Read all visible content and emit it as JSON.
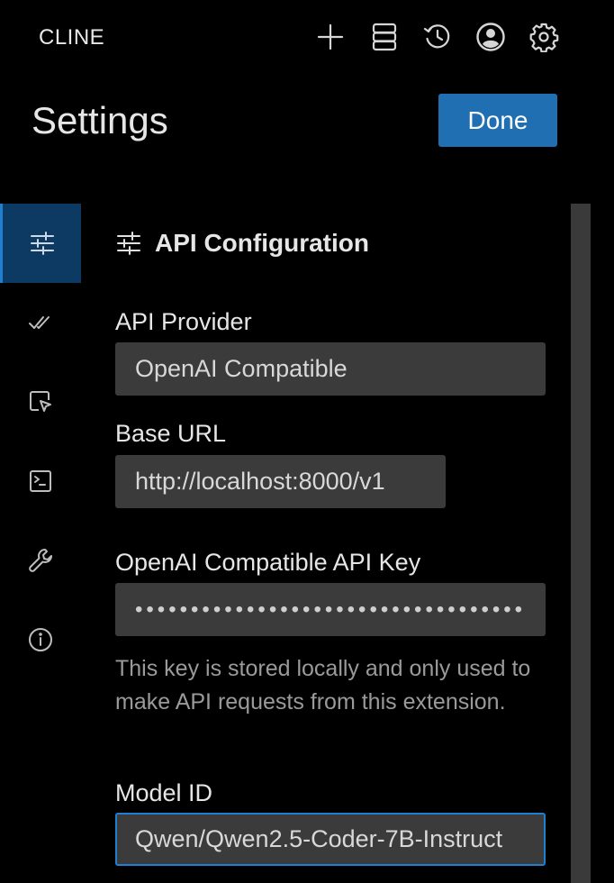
{
  "app": {
    "title": "CLINE"
  },
  "toolbar": {
    "icons": [
      "plus-icon",
      "database-icon",
      "history-icon",
      "account-icon",
      "gear-icon"
    ]
  },
  "header": {
    "title": "Settings",
    "done_label": "Done"
  },
  "sidenav": {
    "items": [
      {
        "icon": "sliders-icon",
        "active": true
      },
      {
        "icon": "double-check-icon",
        "active": false
      },
      {
        "icon": "browser-cursor-icon",
        "active": false
      },
      {
        "icon": "terminal-icon",
        "active": false
      },
      {
        "icon": "wrench-icon",
        "active": false
      },
      {
        "icon": "info-icon",
        "active": false
      }
    ]
  },
  "api_config": {
    "section_title": "API Configuration",
    "provider_label": "API Provider",
    "provider_value": "OpenAI Compatible",
    "base_url_label": "Base URL",
    "base_url_value": "http://localhost:8000/v1",
    "api_key_label": "OpenAI Compatible API Key",
    "api_key_masked": "••••••••••••••••••••••••••••••••••••",
    "api_key_help": "This key is stored locally and only used to make API requests from this extension.",
    "model_id_label": "Model ID",
    "model_id_value": "Qwen/Qwen2.5-Coder-7B-Instruct"
  },
  "colors": {
    "accent": "#1f6fb2",
    "background": "#000000",
    "field_bg": "#3b3b3b",
    "nav_active_bg": "#0c3a63"
  }
}
